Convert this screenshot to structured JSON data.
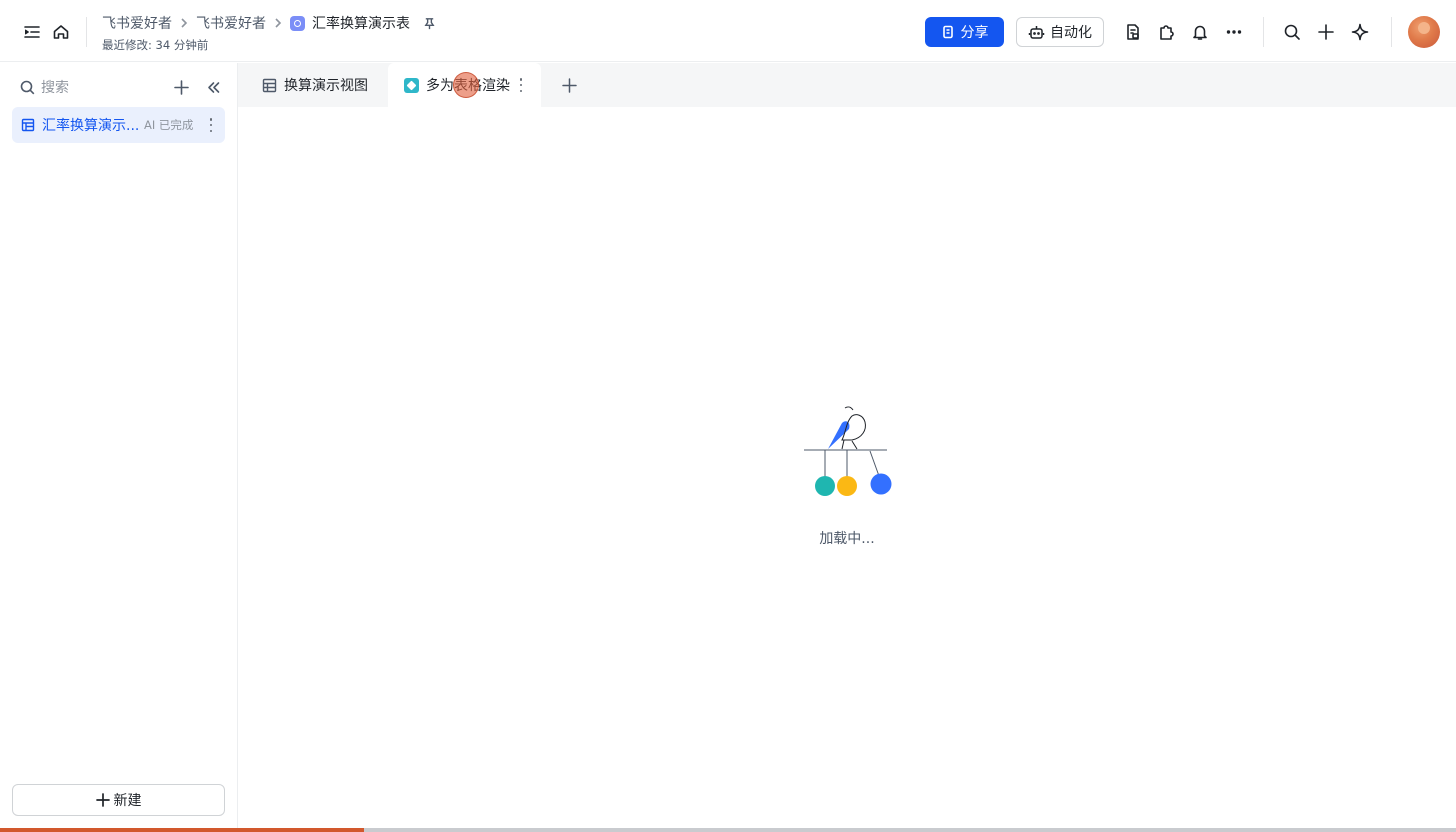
{
  "header": {
    "breadcrumbs": [
      "飞书爱好者",
      "飞书爱好者"
    ],
    "doc_title": "汇率换算演示表",
    "last_modified": "最近修改: 34 分钟前",
    "share_label": "分享",
    "automation_label": "自动化",
    "icons": [
      "sidebar-toggle-icon",
      "home-icon",
      "pin-icon",
      "doc-info-icon",
      "plugin-icon",
      "bell-icon",
      "more-icon",
      "search-icon",
      "plus-icon",
      "ai-sparkle-icon"
    ]
  },
  "sidebar": {
    "search_placeholder": "搜索",
    "items": [
      {
        "label": "汇率换算演示...",
        "badge": "AI 已完成"
      }
    ],
    "new_label": "新建"
  },
  "tabs": [
    {
      "label": "换算演示视图",
      "active": false
    },
    {
      "label": "多为表格渲染",
      "active": true
    }
  ],
  "main": {
    "loading_text": "加载中..."
  },
  "progress": {
    "fraction": 0.25,
    "color": "#d2582d"
  },
  "colors": {
    "accent": "#1456f0",
    "loader_teal": "#1fb6b0",
    "loader_yellow": "#fbb814",
    "loader_blue": "#3370ff"
  }
}
